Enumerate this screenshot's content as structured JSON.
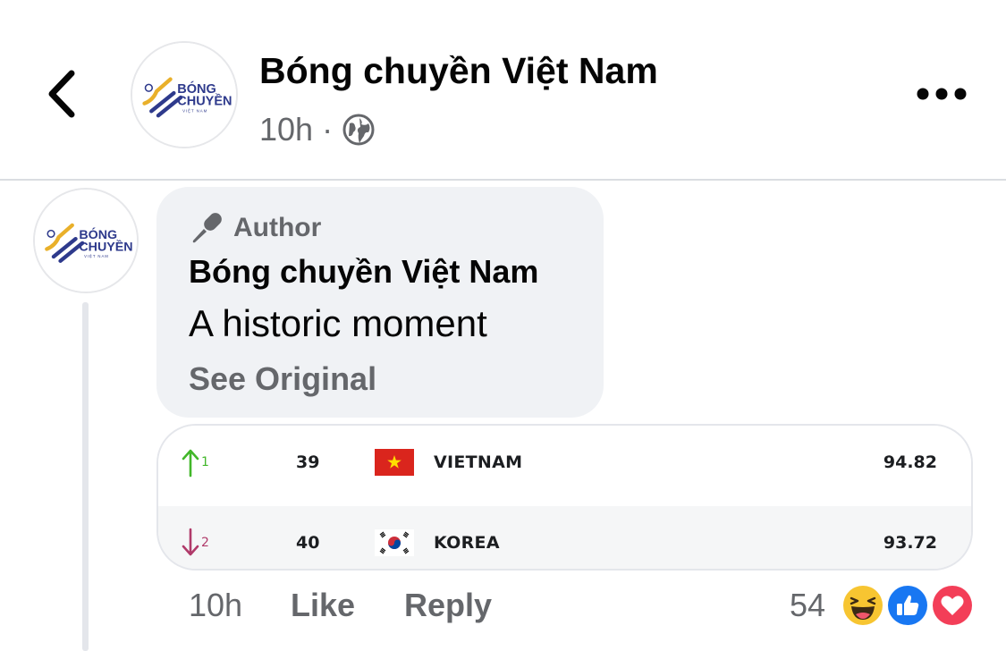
{
  "header": {
    "page_name": "Bóng chuyền Việt Nam",
    "time": "10h",
    "separator": "·",
    "privacy_icon": "globe-icon",
    "back_icon": "chevron-left-icon",
    "more_icon": "more-horizontal-icon"
  },
  "logo": {
    "line1": "BÓNG",
    "line2": "CHUYỀN",
    "line3": "VIỆT NAM",
    "brand_blue": "#2e3a8c",
    "brand_gold": "#e9b02a"
  },
  "comment": {
    "badge_icon": "microphone-icon",
    "badge_label": "Author",
    "author": "Bóng chuyền Việt Nam",
    "text": "A historic moment",
    "see_original": "See Original",
    "time": "10h",
    "like_label": "Like",
    "reply_label": "Reply",
    "reaction_count": "54",
    "reactions": [
      "haha-icon",
      "like-icon",
      "love-icon"
    ]
  },
  "ranking": {
    "rows": [
      {
        "trend": "up",
        "change": "1",
        "rank": "39",
        "country": "VIETNAM",
        "points": "94.82",
        "flag": "vietnam-flag"
      },
      {
        "trend": "down",
        "change": "2",
        "rank": "40",
        "country": "KOREA",
        "points": "93.72",
        "flag": "korea-flag"
      }
    ]
  },
  "colors": {
    "up": "#42b72a",
    "down": "#b03a6a",
    "secondary_text": "#65676b",
    "bubble_bg": "#f0f2f5",
    "like_blue": "#1877f2",
    "love_red": "#f33e58",
    "haha_yellow": "#f7c531"
  }
}
